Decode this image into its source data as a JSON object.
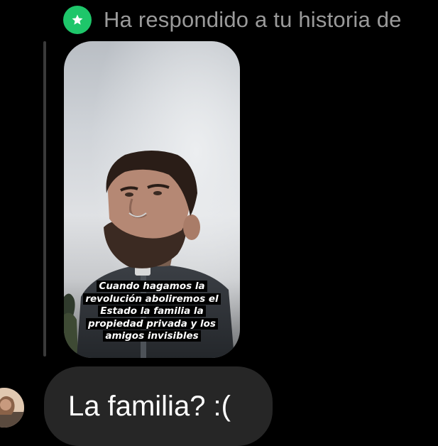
{
  "header": {
    "text": "Ha respondido a tu historia de",
    "icon": "star-icon",
    "badge_color": "#1ec66a"
  },
  "story": {
    "caption_lines": [
      "Cuando hagamos la",
      "revolución aboliremos el",
      "Estado la familia la",
      "propiedad privada y los",
      "amigos invisibles"
    ]
  },
  "message": {
    "text": "La familia? :("
  },
  "avatar": {
    "icon": "avatar"
  }
}
